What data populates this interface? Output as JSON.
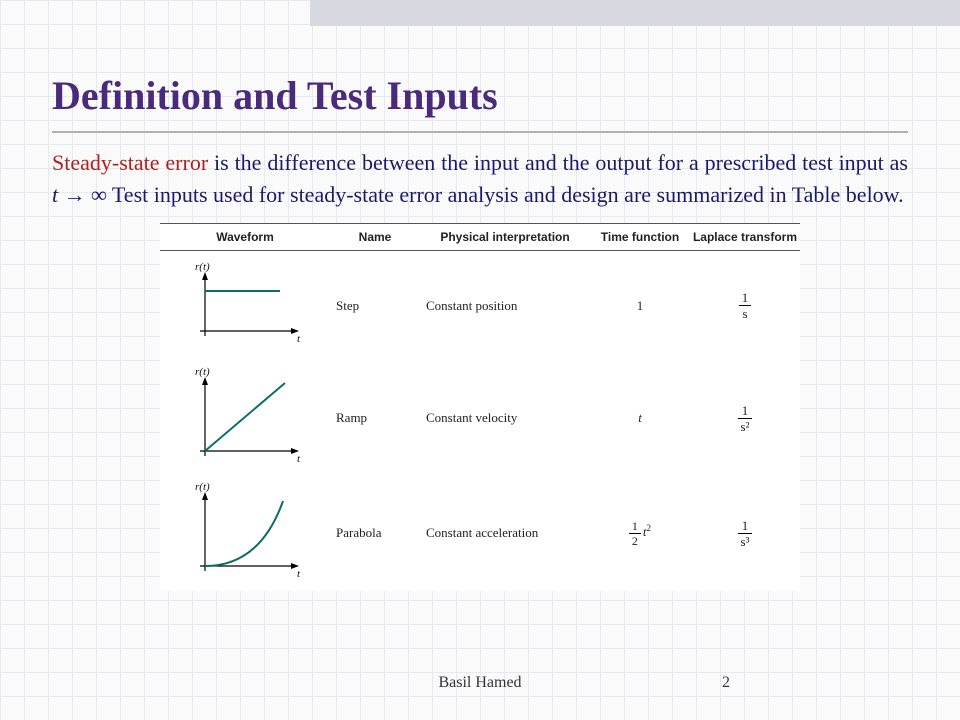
{
  "title": "Definition and Test Inputs",
  "keyword": "Steady-state error",
  "body_rest": " is the difference between the input and the output for a prescribed test input as ",
  "body_math": "t → ∞",
  "body_tail": " Test inputs used for steady-state error analysis and design are summarized in Table below.",
  "table": {
    "headers": {
      "waveform": "Waveform",
      "name": "Name",
      "interp": "Physical interpretation",
      "timefn": "Time function",
      "laplace": "Laplace transform"
    },
    "rows": [
      {
        "name": "Step",
        "interp": "Constant position",
        "timefn": "1",
        "laplace_num": "1",
        "laplace_den": "s",
        "axis_y": "r(t)",
        "axis_x": "t",
        "curve": "step"
      },
      {
        "name": "Ramp",
        "interp": "Constant velocity",
        "timefn": "t",
        "laplace_num": "1",
        "laplace_den": "s²",
        "axis_y": "r(t)",
        "axis_x": "t",
        "curve": "ramp"
      },
      {
        "name": "Parabola",
        "interp": "Constant acceleration",
        "timefn_html": "½ t²",
        "laplace_num": "1",
        "laplace_den": "s³",
        "axis_y": "r(t)",
        "axis_x": "t",
        "curve": "parabola"
      }
    ]
  },
  "footer_author": "Basil Hamed",
  "page_number": "2",
  "chart_data": [
    {
      "type": "line",
      "title": "Step",
      "xlabel": "t",
      "ylabel": "r(t)",
      "x": [
        0,
        1
      ],
      "y": [
        1,
        1
      ],
      "xlim": [
        0,
        1
      ],
      "ylim": [
        0,
        1.2
      ]
    },
    {
      "type": "line",
      "title": "Ramp",
      "xlabel": "t",
      "ylabel": "r(t)",
      "x": [
        0,
        1
      ],
      "y": [
        0,
        1
      ],
      "xlim": [
        0,
        1
      ],
      "ylim": [
        0,
        1
      ]
    },
    {
      "type": "line",
      "title": "Parabola",
      "xlabel": "t",
      "ylabel": "r(t)",
      "x": [
        0,
        0.25,
        0.5,
        0.75,
        1
      ],
      "y": [
        0,
        0.0625,
        0.25,
        0.5625,
        1
      ],
      "xlim": [
        0,
        1
      ],
      "ylim": [
        0,
        1
      ]
    }
  ]
}
